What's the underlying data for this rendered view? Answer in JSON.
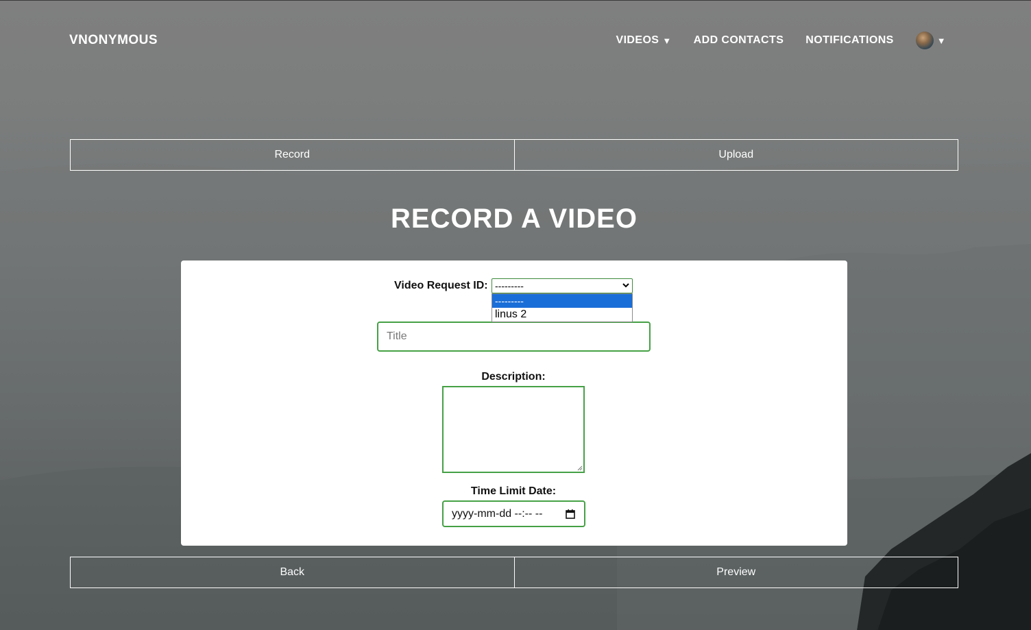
{
  "nav": {
    "brand": "VNONYMOUS",
    "links": [
      {
        "label": "VIDEOS",
        "caret": "▼"
      },
      {
        "label": "ADD CONTACTS"
      },
      {
        "label": "NOTIFICATIONS"
      }
    ],
    "profile_caret": "▼"
  },
  "mode_buttons": {
    "record": "Record",
    "upload": "Upload"
  },
  "page_title": "RECORD A VIDEO",
  "form": {
    "request_label": "Video Request ID:",
    "request_selected": "---------",
    "request_options": [
      "---------",
      "linus 2"
    ],
    "title_placeholder": "Title",
    "description_label": "Description:",
    "description_value": "",
    "time_limit_label": "Time Limit Date:",
    "time_limit_placeholder": "yyyy-mm-dd --:-- --"
  },
  "footer_buttons": {
    "back": "Back",
    "preview": "Preview"
  },
  "colors": {
    "input_border": "#45a045",
    "selected_option": "#1a6ed8",
    "text_on_dark": "#ffffff"
  }
}
